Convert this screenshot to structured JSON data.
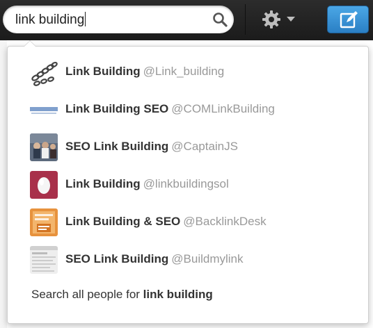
{
  "search": {
    "value": "link building"
  },
  "results": [
    {
      "name": "Link Building",
      "handle": "@Link_building",
      "avatar": "chain-image"
    },
    {
      "name": "Link Building SEO",
      "handle": "@COMLinkBuilding",
      "avatar": "complete-logo"
    },
    {
      "name": "SEO Link Building",
      "handle": "@CaptainJS",
      "avatar": "photo-group"
    },
    {
      "name": "Link Building",
      "handle": "@linkbuildingsol",
      "avatar": "default-egg"
    },
    {
      "name": "Link Building & SEO",
      "handle": "@BacklinkDesk",
      "avatar": "orange-sign"
    },
    {
      "name": "SEO Link Building",
      "handle": "@Buildmylink",
      "avatar": "webpage-screenshot"
    }
  ],
  "search_all": {
    "prefix": "Search all people for",
    "query": "link building"
  },
  "colors": {
    "compose": "#2a7fc4",
    "egg_bg": "#a8304a",
    "handle": "#999999",
    "topbar": "#222222"
  }
}
